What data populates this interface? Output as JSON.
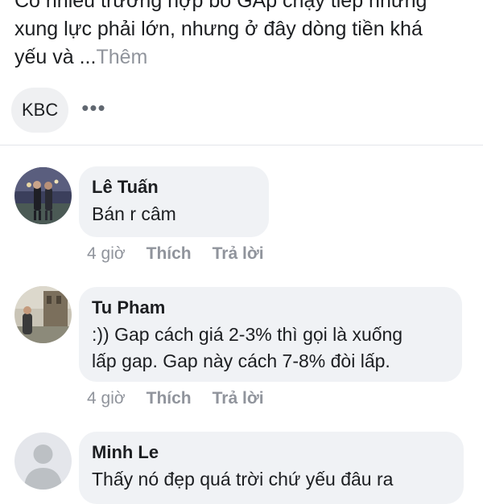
{
  "post": {
    "lines": [
      "Có nhiều trường hợp bò GAp chạy tiếp nhưng",
      "xung lực phải lớn, nhưng ở đây dòng tiền khá",
      "yếu và ..."
    ],
    "see_more": "Thêm"
  },
  "tag": {
    "label": "KBC",
    "more_icon": "more-horizontal-icon"
  },
  "comments": [
    {
      "author": "Lê Tuấn",
      "lines": [
        "Bán r câm"
      ],
      "time": "4 giờ",
      "like_label": "Thích",
      "reply_label": "Trả lời"
    },
    {
      "author": "Tu Pham",
      "lines": [
        ":)) Gap cách giá 2-3% thì gọi là xuống",
        "lấp gap. Gap này cách 7-8% đòi lấp."
      ],
      "time": "4 giờ",
      "like_label": "Thích",
      "reply_label": "Trả lời"
    },
    {
      "author": "Minh Le",
      "lines": [
        "Thấy nó đẹp quá trời chứ yếu đâu ra"
      ]
    }
  ],
  "colors": {
    "bubble": "#f0f2f5",
    "muted": "#90949c",
    "text": "#1c1e21"
  }
}
